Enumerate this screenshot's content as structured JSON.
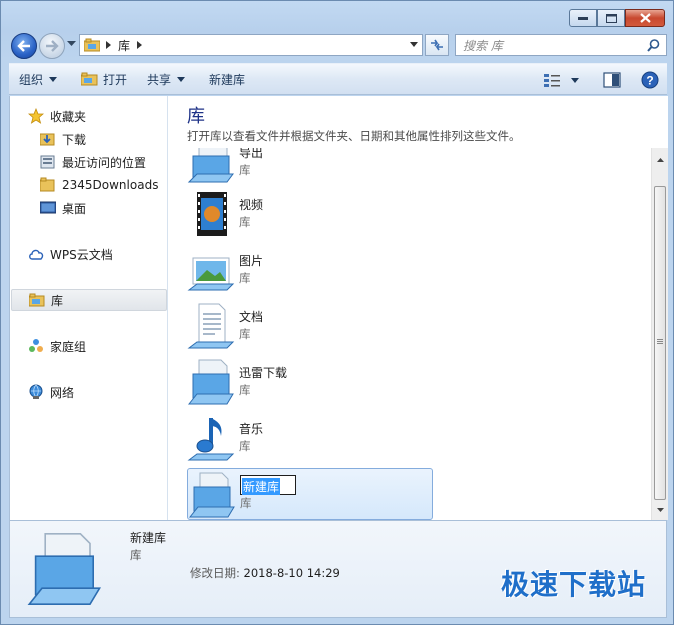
{
  "window": {
    "title": "",
    "caption": {
      "minimize": "minimize",
      "maximize": "maximize",
      "close": "close"
    }
  },
  "address_bar": {
    "breadcrumb": [
      "库"
    ],
    "search_placeholder": "搜索 库"
  },
  "toolbar": {
    "organize": "组织",
    "open": "打开",
    "share": "共享",
    "new_library": "新建库"
  },
  "nav_pane": {
    "favorites_label": "收藏夹",
    "favorites": [
      {
        "label": "下载",
        "icon": "download-folder-icon"
      },
      {
        "label": "最近访问的位置",
        "icon": "recent-places-icon"
      },
      {
        "label": "2345Downloads",
        "icon": "folder-icon"
      },
      {
        "label": "桌面",
        "icon": "desktop-icon"
      }
    ],
    "wps_label": "WPS云文档",
    "libraries_label": "库",
    "homegroup_label": "家庭组",
    "network_label": "网络"
  },
  "content": {
    "title": "库",
    "description": "打开库以查看文件并根据文件夹、日期和其他属性排列这些文件。",
    "items": [
      {
        "name": "导出",
        "kind": "库",
        "icon": "generic-library-icon"
      },
      {
        "name": "视频",
        "kind": "库",
        "icon": "video-library-icon"
      },
      {
        "name": "图片",
        "kind": "库",
        "icon": "pictures-library-icon"
      },
      {
        "name": "文档",
        "kind": "库",
        "icon": "documents-library-icon"
      },
      {
        "name": "迅雷下载",
        "kind": "库",
        "icon": "generic-library-icon"
      },
      {
        "name": "音乐",
        "kind": "库",
        "icon": "music-library-icon"
      },
      {
        "name": "新建库",
        "kind": "库",
        "icon": "generic-library-icon",
        "renaming": true
      }
    ]
  },
  "details": {
    "name": "新建库",
    "kind": "库",
    "modified_label": "修改日期:",
    "modified_value": "2018-8-10 14:29"
  },
  "watermark": "极速下载站",
  "colors": {
    "accent": "#1e3287",
    "selection": "#d5e8fb",
    "watermark": "#1f6fc9"
  }
}
